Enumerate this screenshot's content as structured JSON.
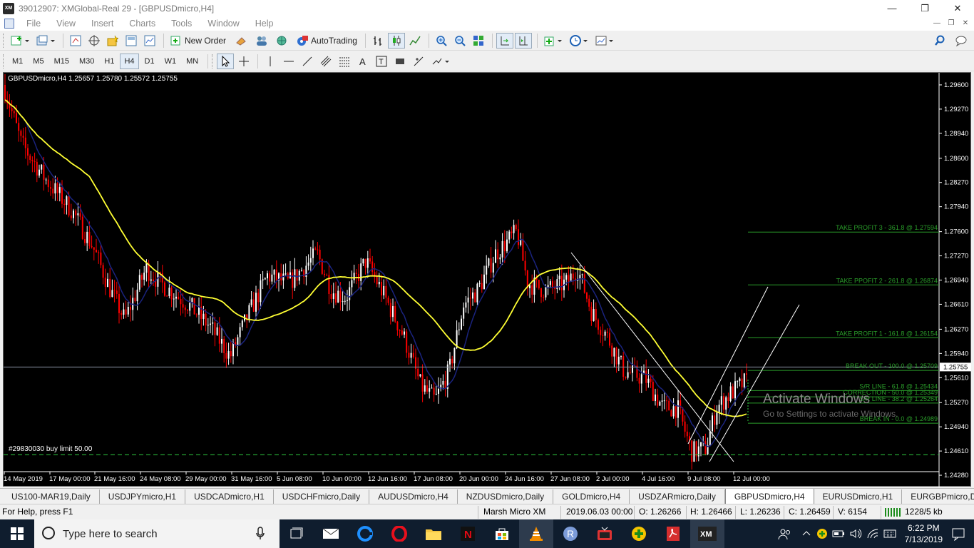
{
  "window": {
    "title": "39012907: XMGlobal-Real 29 - [GBPUSDmicro,H4]",
    "logo": "XM",
    "controls": [
      "minimize",
      "restore",
      "close"
    ]
  },
  "menu": [
    "File",
    "View",
    "Insert",
    "Charts",
    "Tools",
    "Window",
    "Help"
  ],
  "toolbar1": {
    "new_order": "New Order",
    "auto_trading": "AutoTrading"
  },
  "timeframes": [
    "M1",
    "M5",
    "M15",
    "M30",
    "H1",
    "H4",
    "D1",
    "W1",
    "MN"
  ],
  "active_timeframe": "H4",
  "chart": {
    "symbol_info": "GBPUSDmicro,H4  1.25657 1.25780 1.25572 1.25755",
    "order_label": "#29830030 buy limit 50.00",
    "current_price": "1.25755",
    "price_labels": [
      "1.29600",
      "1.29270",
      "1.28940",
      "1.28600",
      "1.28270",
      "1.27940",
      "1.27600",
      "1.27270",
      "1.26940",
      "1.26610",
      "1.26270",
      "1.25940",
      "1.25610",
      "1.25270",
      "1.24940",
      "1.24610",
      "1.24280"
    ],
    "time_labels": [
      "14 May 2019",
      "17 May 00:00",
      "21 May 16:00",
      "24 May 08:00",
      "29 May 00:00",
      "31 May 16:00",
      "5 Jun 08:00",
      "10 Jun 00:00",
      "12 Jun 16:00",
      "17 Jun 08:00",
      "20 Jun 00:00",
      "24 Jun 16:00",
      "27 Jun 08:00",
      "2 Jul 00:00",
      "4 Jul 16:00",
      "9 Jul 08:00",
      "12 Jul 00:00"
    ],
    "levels": [
      {
        "label": "TAKE PROFIT 3  -  361.8  @ 1.27594",
        "price": 1.27594
      },
      {
        "label": "TAKE PPOFIT 2  -  261.8  @ 1.26874",
        "price": 1.26874
      },
      {
        "label": "TAKE PROFIT 1  -  161.8  @ 1.26154",
        "price": 1.26154
      },
      {
        "label": "BREAK OUT  -  100.0  @ 1.25709",
        "price": 1.25709
      },
      {
        "label": "S/R LINE  -  61.8  @ 1.25434",
        "price": 1.25434
      },
      {
        "label": "CORRECTION  -  50.0  @ 1.25349",
        "price": 1.25349
      },
      {
        "label": "S/R LINE  -  38.2  @ 1.25264",
        "price": 1.25264
      },
      {
        "label": "BREAK IN  -  0.0  @ 1.24989",
        "price": 1.24989
      }
    ],
    "buy_limit_price": 1.2456,
    "colors": {
      "bull": "#ffffff",
      "bear": "#ff0000",
      "ma_fast": "#1a237e",
      "ma_slow": "#ffff33",
      "levels": "#2a9d2a"
    }
  },
  "watermark": {
    "title": "Activate Windows",
    "subtitle": "Go to Settings to activate Windows."
  },
  "tabs": [
    "US100-MAR19,Daily",
    "USDJPYmicro,H1",
    "USDCADmicro,H1",
    "USDCHFmicro,Daily",
    "AUDUSDmicro,H4",
    "NZDUSDmicro,Daily",
    "GOLDmicro,H4",
    "USDZARmicro,Daily",
    "GBPUSDmicro,H4",
    "EURUSDmicro,H1",
    "EURGBPmicro,Daily"
  ],
  "active_tab": "GBPUSDmicro,H4",
  "status": {
    "help": "For Help, press F1",
    "profile": "Marsh Micro XM",
    "datetime": "2019.06.03 00:00",
    "open": "O: 1.26266",
    "high": "H: 1.26466",
    "low": "L: 1.26236",
    "close": "C: 1.26459",
    "volume": "V: 6154",
    "traffic": "1228/5 kb"
  },
  "taskbar": {
    "search_placeholder": "Type here to search",
    "time": "6:22 PM",
    "date": "7/13/2019"
  }
}
